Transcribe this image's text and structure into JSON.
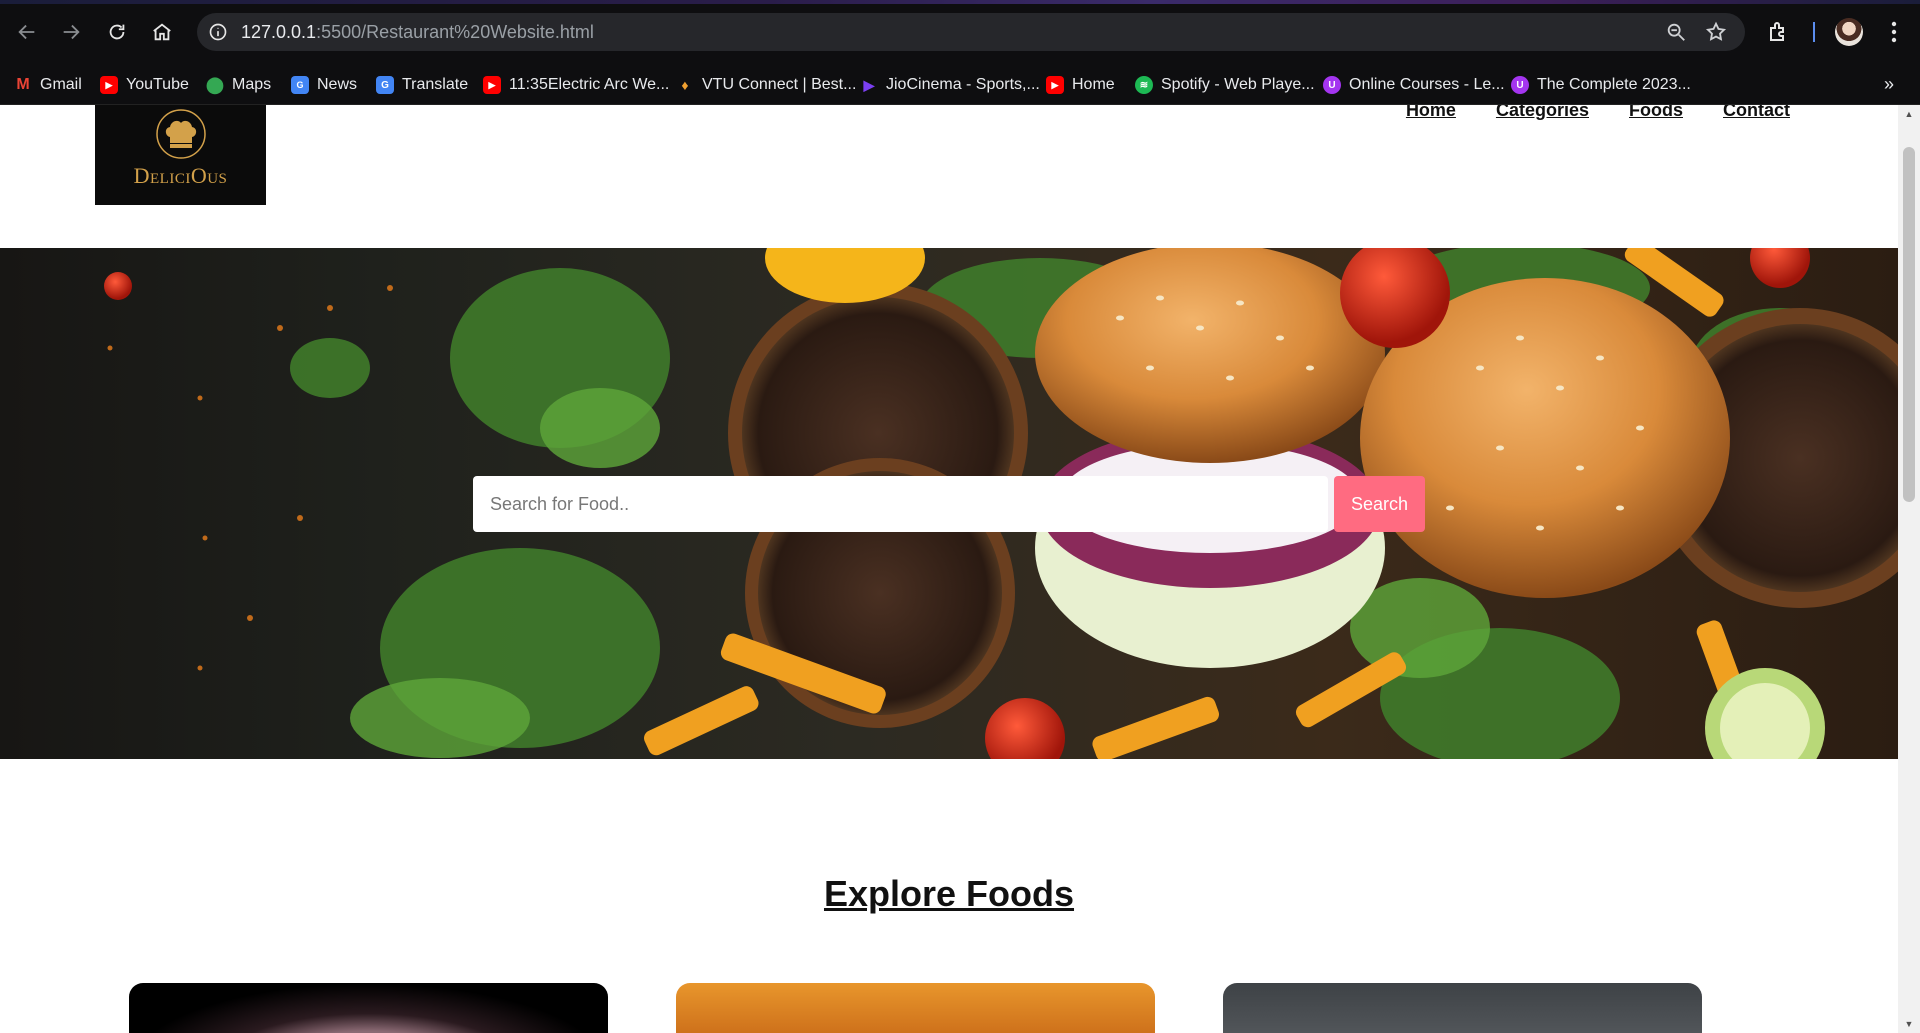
{
  "browser": {
    "url_host": "127.0.0.1",
    "url_rest": ":5500/Restaurant%20Website.html",
    "bookmarks": [
      {
        "label": "Gmail",
        "icon": "gmail-icon",
        "color": "#ea4335"
      },
      {
        "label": "YouTube",
        "icon": "youtube-icon",
        "color": "#ff0000"
      },
      {
        "label": "Maps",
        "icon": "maps-icon",
        "color": "#34a853"
      },
      {
        "label": "News",
        "icon": "news-icon",
        "color": "#4285f4"
      },
      {
        "label": "Translate",
        "icon": "translate-icon",
        "color": "#4285f4"
      },
      {
        "label": "11:35Electric Arc We...",
        "icon": "youtube-icon",
        "color": "#ff0000"
      },
      {
        "label": "VTU Connect | Best...",
        "icon": "vtu-icon",
        "color": "#f0a030"
      },
      {
        "label": "JioCinema - Sports,...",
        "icon": "jiocinema-icon",
        "color": "#7b3ff2"
      },
      {
        "label": "Home",
        "icon": "youtube-icon",
        "color": "#ff0000"
      },
      {
        "label": "Spotify - Web Playe...",
        "icon": "spotify-icon",
        "color": "#1db954"
      },
      {
        "label": "Online Courses - Le...",
        "icon": "udemy-icon",
        "color": "#a435f0"
      },
      {
        "label": "The Complete 2023...",
        "icon": "udemy-icon",
        "color": "#a435f0"
      }
    ]
  },
  "site": {
    "logo_text": "DeliciOus",
    "nav": [
      "Home",
      "Categories",
      "Foods",
      "Contact"
    ],
    "search_placeholder": "Search for Food..",
    "search_button": "Search",
    "section_title": "Explore Foods",
    "accent_color": "#ff6b81"
  }
}
